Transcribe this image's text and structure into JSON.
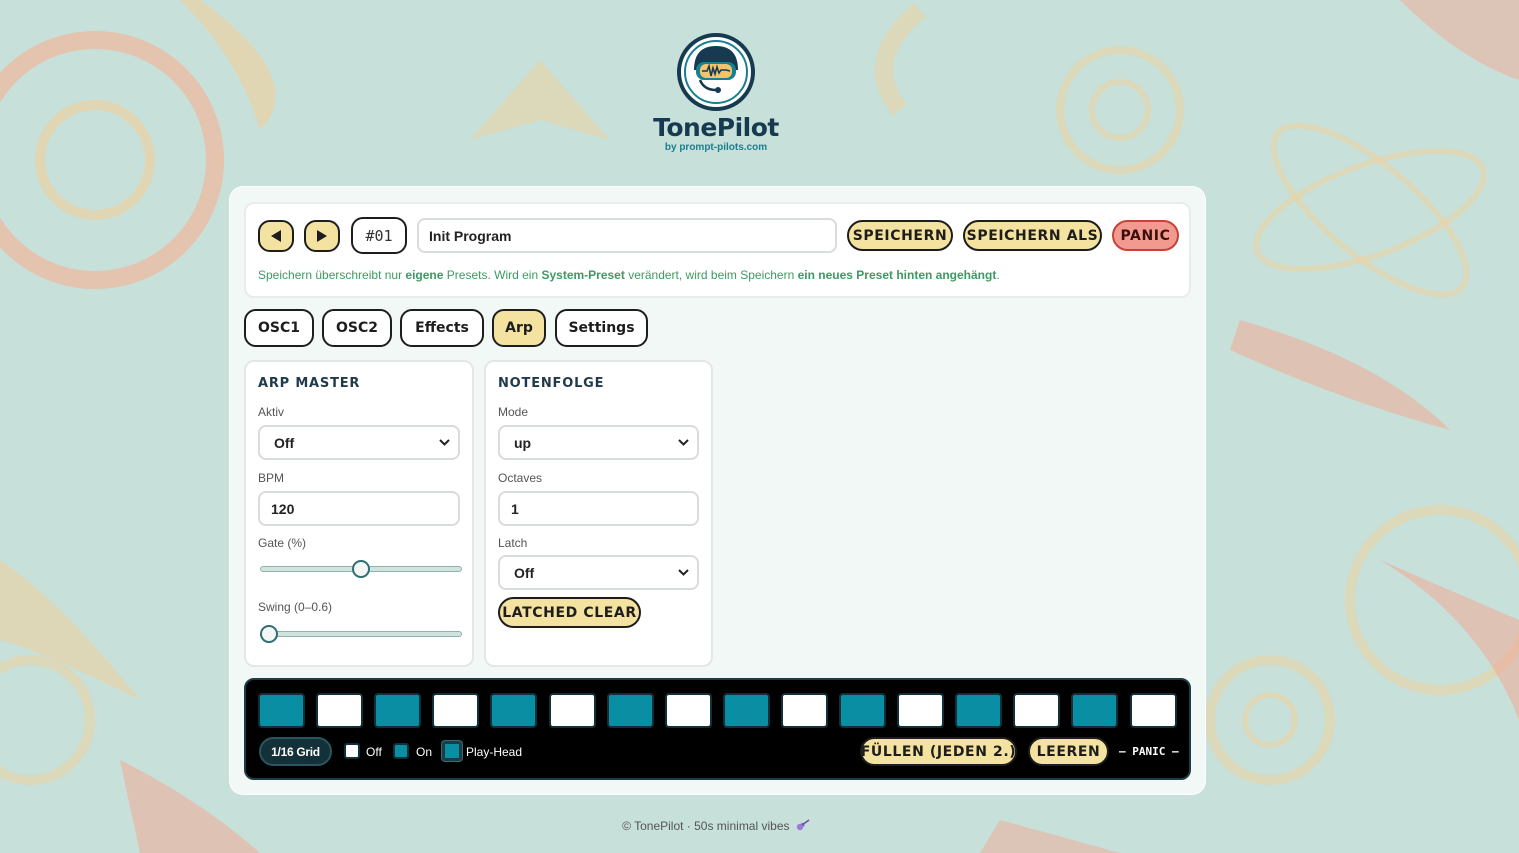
{
  "brand": {
    "name": "TonePilot",
    "sub": "by prompt-pilots.com"
  },
  "preset": {
    "prev_icon": "play-left-icon",
    "next_icon": "play-right-icon",
    "number": "#01",
    "name_value": "Init Program",
    "save_label": "SPEICHERN",
    "save_as_label": "SPEICHERN ALS",
    "panic_label": "PANIC",
    "note": {
      "p1": "Speichern überschreibt nur ",
      "b1": "eigene",
      "p2": " Presets. Wird ein ",
      "b2": "System-Preset",
      "p3": " verändert, wird beim Speichern ",
      "b3": "ein neues Preset hinten angehängt",
      "p4": "."
    }
  },
  "tabs": [
    {
      "label": "OSC1",
      "active": false
    },
    {
      "label": "OSC2",
      "active": false
    },
    {
      "label": "Effects",
      "active": false
    },
    {
      "label": "Arp",
      "active": true
    },
    {
      "label": "Settings",
      "active": false
    }
  ],
  "arp_master": {
    "title": "ARP MASTER",
    "aktiv_label": "Aktiv",
    "aktiv_value": "Off",
    "bpm_label": "BPM",
    "bpm_value": "120",
    "gate_label": "Gate (%)",
    "gate_value": 0.5,
    "swing_label": "Swing (0–0.6)",
    "swing_value": 0.0
  },
  "notenfolge": {
    "title": "NOTENFOLGE",
    "mode_label": "Mode",
    "mode_value": "up",
    "octaves_label": "Octaves",
    "octaves_value": "1",
    "latch_label": "Latch",
    "latch_value": "Off",
    "latched_clear_label": "LATCHED CLEAR"
  },
  "sequencer": {
    "steps": [
      true,
      false,
      true,
      false,
      true,
      false,
      true,
      false,
      true,
      false,
      true,
      false,
      true,
      false,
      true,
      false
    ],
    "grid_label": "1/16 Grid",
    "legend_off": "Off",
    "legend_on": "On",
    "legend_playhead": "Play-Head",
    "fill_label": "FÜLLEN (JEDEN 2.)",
    "clear_label": "LEEREN",
    "panic_label": "– PANIC –"
  },
  "colors": {
    "accent_yellow": "#f4e3a0",
    "step_on": "#0a8ea3",
    "panic_red": "#f29a8f",
    "note_green": "#3d9a63"
  },
  "footer": {
    "text": "© TonePilot · 50s minimal vibes",
    "icon": "guitar-icon"
  }
}
